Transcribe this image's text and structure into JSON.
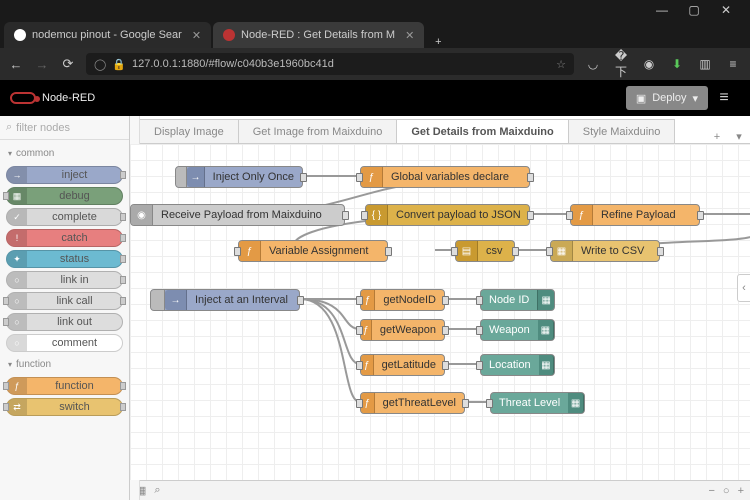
{
  "browser": {
    "tabs": [
      {
        "title": "nodemcu pinout - Google Sear",
        "fav": "#fff"
      },
      {
        "title": "Node-RED : Get Details from M",
        "fav": "#b33"
      }
    ],
    "url": "127.0.0.1:1880/#flow/c040b3e1960bc41d",
    "win": {
      "min": "—",
      "max": "▢",
      "close": "✕"
    }
  },
  "app": {
    "brand": "Node-RED",
    "deploy": "Deploy"
  },
  "palette": {
    "filter_placeholder": "filter nodes",
    "cats": [
      {
        "name": "common",
        "nodes": [
          {
            "label": "inject",
            "bg": "#9aa8c9",
            "icon": "→",
            "ports": "r"
          },
          {
            "label": "debug",
            "bg": "#7aa07a",
            "icon": "▦",
            "ports": "l"
          },
          {
            "label": "complete",
            "bg": "#d9d9d9",
            "icon": "✓",
            "ports": "r"
          },
          {
            "label": "catch",
            "bg": "#e77f7f",
            "icon": "!",
            "ports": "r"
          },
          {
            "label": "status",
            "bg": "#6cbad1",
            "icon": "✦",
            "ports": "r"
          },
          {
            "label": "link in",
            "bg": "#ddd",
            "icon": "○",
            "ports": "r"
          },
          {
            "label": "link call",
            "bg": "#ddd",
            "icon": "○",
            "ports": "lr"
          },
          {
            "label": "link out",
            "bg": "#ddd",
            "icon": "○",
            "ports": "l"
          },
          {
            "label": "comment",
            "bg": "#fff",
            "icon": "○",
            "ports": ""
          }
        ]
      },
      {
        "name": "function",
        "nodes": [
          {
            "label": "function",
            "bg": "#f4b56a",
            "icon": "ƒ",
            "ports": "lr"
          },
          {
            "label": "switch",
            "bg": "#e8c370",
            "icon": "⇄",
            "ports": "lr"
          }
        ]
      }
    ]
  },
  "flowtabs": [
    "Display Image",
    "Get Image from Maixduino",
    "Get Details from Maixduino",
    "Style Maixduino"
  ],
  "flowtab_active": 2,
  "nodes": {
    "inject_once": "Inject Only Once",
    "globals": "Global variables declare",
    "receive": "Receive Payload from Maixduino",
    "convert": "Convert payload to JSON",
    "refine": "Refine Payload",
    "varassign": "Variable Assignment",
    "csv": "csv",
    "writecsv": "Write to CSV",
    "inject_int": "Inject at an Interval",
    "getnode": "getNodeID",
    "getweapon": "getWeapon",
    "getlat": "getLatitude",
    "getthreat": "getThreatLevel",
    "d_node": "Node ID",
    "d_weapon": "Weapon",
    "d_loc": "Location",
    "d_threat": "Threat Level"
  },
  "footer": {
    "zoom_reset": "○",
    "zoom_in": "+",
    "zoom_out": "−"
  }
}
